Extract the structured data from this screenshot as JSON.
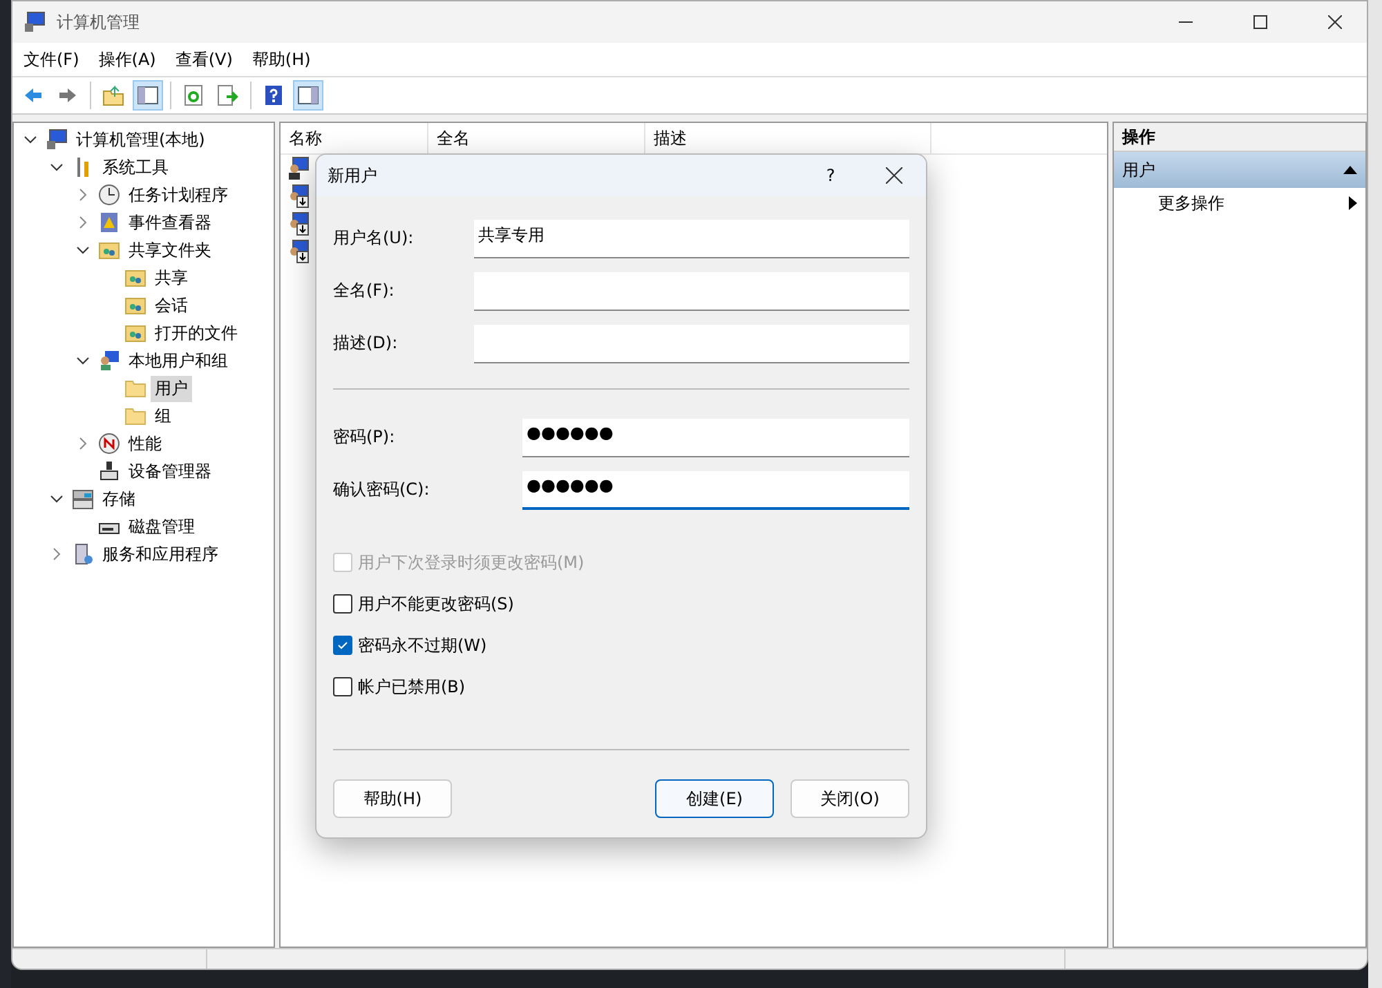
{
  "window": {
    "title": "计算机管理"
  },
  "menu": [
    {
      "label": "文件(F)"
    },
    {
      "label": "操作(A)"
    },
    {
      "label": "查看(V)"
    },
    {
      "label": "帮助(H)"
    }
  ],
  "toolbar": [
    {
      "kind": "back",
      "pressed": false
    },
    {
      "kind": "forward",
      "pressed": false
    },
    {
      "kind": "sep"
    },
    {
      "kind": "up",
      "pressed": false
    },
    {
      "kind": "tree",
      "pressed": true
    },
    {
      "kind": "sep"
    },
    {
      "kind": "refresh",
      "pressed": false
    },
    {
      "kind": "export",
      "pressed": false
    },
    {
      "kind": "sep"
    },
    {
      "kind": "help",
      "pressed": false
    },
    {
      "kind": "actionpane",
      "pressed": true
    }
  ],
  "tree": [
    {
      "label": "计算机管理(本地)",
      "kind": "computer",
      "expanded": true,
      "selected": false,
      "children": [
        {
          "label": "系统工具",
          "kind": "tools",
          "expanded": true,
          "selected": false,
          "children": [
            {
              "label": "任务计划程序",
              "kind": "clock",
              "expanded": false,
              "selected": false
            },
            {
              "label": "事件查看器",
              "kind": "events",
              "expanded": false,
              "selected": false
            },
            {
              "label": "共享文件夹",
              "kind": "shares",
              "expanded": true,
              "selected": false,
              "children": [
                {
                  "label": "共享",
                  "kind": "shares",
                  "selected": false
                },
                {
                  "label": "会话",
                  "kind": "shares",
                  "selected": false
                },
                {
                  "label": "打开的文件",
                  "kind": "shares",
                  "selected": false
                }
              ]
            },
            {
              "label": "本地用户和组",
              "kind": "users",
              "expanded": true,
              "selected": false,
              "children": [
                {
                  "label": "用户",
                  "kind": "folder",
                  "selected": true
                },
                {
                  "label": "组",
                  "kind": "folder",
                  "selected": false
                }
              ]
            },
            {
              "label": "性能",
              "kind": "perf",
              "expanded": false,
              "selected": false
            },
            {
              "label": "设备管理器",
              "kind": "device",
              "selected": false
            }
          ]
        },
        {
          "label": "存储",
          "kind": "storage",
          "expanded": true,
          "selected": false,
          "children": [
            {
              "label": "磁盘管理",
              "kind": "disk",
              "selected": false
            }
          ]
        },
        {
          "label": "服务和应用程序",
          "kind": "services",
          "expanded": false,
          "selected": false
        }
      ]
    }
  ],
  "list": {
    "columns": [
      {
        "label": "名称"
      },
      {
        "label": "全名"
      },
      {
        "label": "描述"
      }
    ],
    "rows": [
      {
        "kind": "user"
      },
      {
        "kind": "user-disabled"
      },
      {
        "kind": "user-disabled"
      },
      {
        "kind": "user-disabled"
      }
    ]
  },
  "actions": {
    "title": "操作",
    "sections": [
      {
        "label": "用户",
        "expanded": true,
        "items": [
          {
            "label": "更多操作"
          }
        ]
      }
    ]
  },
  "dialog": {
    "title": "新用户",
    "help": "?",
    "fields": [
      {
        "label": "用户名(U):",
        "value": "共享专用",
        "focused": false,
        "kind": "text"
      },
      {
        "label": "全名(F):",
        "focused": false,
        "kind": "text"
      },
      {
        "label": "描述(D):",
        "focused": false,
        "kind": "text"
      },
      {
        "label": "密码(P):",
        "value": "●●●●●●",
        "focused": false,
        "kind": "password"
      },
      {
        "label": "确认密码(C):",
        "value": "●●●●●●",
        "focused": true,
        "kind": "password"
      }
    ],
    "checkboxes": [
      {
        "label": "用户下次登录时须更改密码(M)",
        "checked": false,
        "disabled": true
      },
      {
        "label": "用户不能更改密码(S)",
        "checked": false,
        "disabled": false
      },
      {
        "label": "密码永不过期(W)",
        "checked": true,
        "disabled": false
      },
      {
        "label": "帐户已禁用(B)",
        "checked": false,
        "disabled": false
      }
    ],
    "buttons": [
      {
        "label": "帮助(H)",
        "default": false
      },
      {
        "label": "创建(E)",
        "default": true
      },
      {
        "label": "关闭(O)",
        "default": false
      }
    ]
  }
}
